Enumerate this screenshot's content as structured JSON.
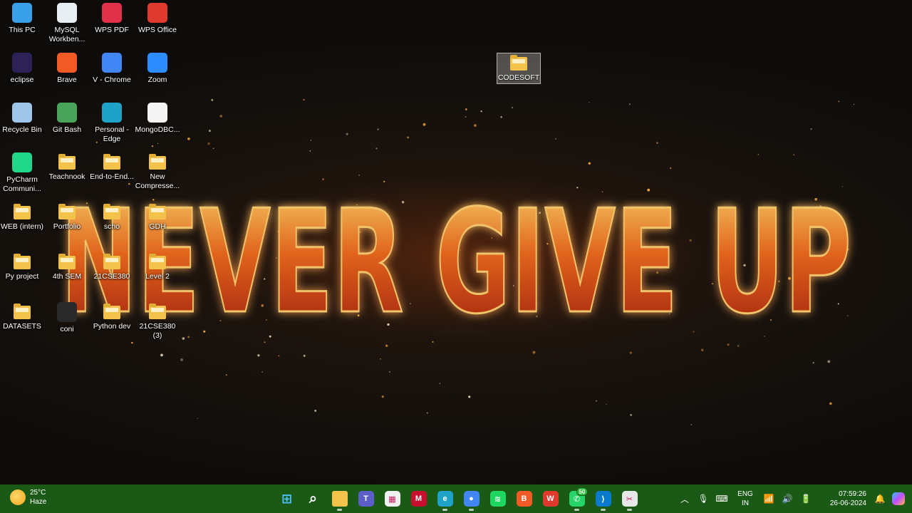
{
  "wallpaper": {
    "text": "NEVER GIVE UP"
  },
  "desktop_icons": [
    {
      "label": "This PC",
      "icon": "this-pc-icon",
      "color": "#3aa0e8"
    },
    {
      "label": "MySQL Workben...",
      "icon": "mysql-workbench-icon",
      "color": "#e9eef3"
    },
    {
      "label": "WPS PDF",
      "icon": "wps-pdf-icon",
      "color": "#e0304a"
    },
    {
      "label": "WPS Office",
      "icon": "wps-office-icon",
      "color": "#e03a2e"
    },
    {
      "label": "eclipse",
      "icon": "eclipse-icon",
      "color": "#2c2255"
    },
    {
      "label": "Brave",
      "icon": "brave-icon",
      "color": "#f15a24"
    },
    {
      "label": "V - Chrome",
      "icon": "chrome-icon",
      "color": "#4285f4"
    },
    {
      "label": "Zoom",
      "icon": "zoom-icon",
      "color": "#2d8cff"
    },
    {
      "label": "Recycle Bin",
      "icon": "recycle-bin-icon",
      "color": "#9fc6e8"
    },
    {
      "label": "Git Bash",
      "icon": "git-bash-icon",
      "color": "#4aa35a"
    },
    {
      "label": "Personal - Edge",
      "icon": "edge-icon",
      "color": "#1fa2c8"
    },
    {
      "label": "MongoDBC...",
      "icon": "mongodb-compass-icon",
      "color": "#f4f4f4"
    },
    {
      "label": "PyCharm Communi...",
      "icon": "pycharm-icon",
      "color": "#21d789"
    },
    {
      "label": "Teachnook",
      "icon": "folder-icon",
      "color": "#f3c24a"
    },
    {
      "label": "End-to-End...",
      "icon": "folder-icon",
      "color": "#f3c24a"
    },
    {
      "label": "New Compresse...",
      "icon": "folder-icon",
      "color": "#f3c24a"
    },
    {
      "label": "WEB (intern)",
      "icon": "folder-icon",
      "color": "#f3c24a"
    },
    {
      "label": "Portfolio",
      "icon": "folder-icon",
      "color": "#f3c24a"
    },
    {
      "label": "scho",
      "icon": "folder-icon",
      "color": "#f3c24a"
    },
    {
      "label": "GDH",
      "icon": "folder-icon",
      "color": "#f3c24a"
    },
    {
      "label": "Py project",
      "icon": "folder-icon",
      "color": "#f3c24a"
    },
    {
      "label": "4th SEM",
      "icon": "folder-icon",
      "color": "#f3c24a"
    },
    {
      "label": "21CSE380",
      "icon": "folder-icon",
      "color": "#f3c24a"
    },
    {
      "label": "Level 2",
      "icon": "folder-icon",
      "color": "#f3c24a"
    },
    {
      "label": "DATASETS",
      "icon": "folder-icon",
      "color": "#f3c24a"
    },
    {
      "label": "coni",
      "icon": "terminal-icon",
      "color": "#2a2a2a"
    },
    {
      "label": "Python dev",
      "icon": "folder-icon",
      "color": "#f3c24a"
    },
    {
      "label": "21CSE380 (3)",
      "icon": "folder-icon",
      "color": "#f3c24a"
    }
  ],
  "selected_folder": {
    "label": "CODESOFT",
    "icon": "folder-icon"
  },
  "taskbar": {
    "weather": {
      "temp": "25°C",
      "condition": "Haze"
    },
    "apps": [
      {
        "name": "start",
        "icon": "windows-start-icon",
        "color": "#4cc2ff",
        "glyph": "⊞"
      },
      {
        "name": "search",
        "icon": "search-icon",
        "color": "transparent",
        "glyph": "⌕"
      },
      {
        "name": "file-explorer",
        "icon": "file-explorer-icon",
        "color": "#f3c24a",
        "glyph": ""
      },
      {
        "name": "teams",
        "icon": "teams-icon",
        "color": "#5b5fc7",
        "glyph": "T"
      },
      {
        "name": "microsoft-store",
        "icon": "store-icon",
        "color": "#f0f0f0",
        "glyph": "▦"
      },
      {
        "name": "mcafee",
        "icon": "mcafee-icon",
        "color": "#c8102e",
        "glyph": "M"
      },
      {
        "name": "edge",
        "icon": "edge-icon",
        "color": "#1fa2c8",
        "glyph": "e"
      },
      {
        "name": "chrome",
        "icon": "chrome-icon",
        "color": "#4285f4",
        "glyph": "●"
      },
      {
        "name": "spotify",
        "icon": "spotify-icon",
        "color": "#1ed760",
        "glyph": "≋"
      },
      {
        "name": "brave",
        "icon": "brave-icon",
        "color": "#f15a24",
        "glyph": "B"
      },
      {
        "name": "wps-office",
        "icon": "wps-office-icon",
        "color": "#e03a2e",
        "glyph": "W"
      },
      {
        "name": "whatsapp",
        "icon": "whatsapp-icon",
        "color": "#25d366",
        "glyph": "✆",
        "badge": "50"
      },
      {
        "name": "vscode",
        "icon": "vscode-icon",
        "color": "#0a7acc",
        "glyph": "⟩"
      },
      {
        "name": "snipping-tool",
        "icon": "snipping-tool-icon",
        "color": "#e8e8e8",
        "glyph": "✂"
      }
    ],
    "tray": {
      "language": "ENG",
      "region": "IN",
      "time": "07:59:26",
      "date": "26-06-2024"
    }
  }
}
